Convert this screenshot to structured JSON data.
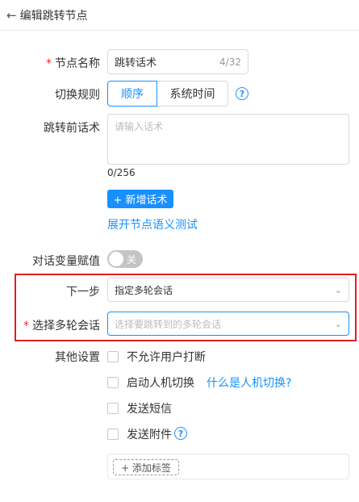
{
  "header": {
    "back_icon": "←",
    "title": "编辑跳转节点"
  },
  "node_name": {
    "label": "节点名称",
    "required_mark": "*",
    "value": "跳转话术",
    "count": "4/32"
  },
  "switch_rule": {
    "label": "切换规则",
    "options": [
      "顺序",
      "系统时间"
    ],
    "selected": "顺序",
    "help_icon": "?"
  },
  "pre_jump": {
    "label": "跳转前话术",
    "placeholder": "请输入话术",
    "count": "0/256",
    "add_button": "+ 新增话术",
    "expand_link": "展开节点语义测试"
  },
  "var_assign": {
    "label": "对话变量赋值",
    "toggle_text": "关"
  },
  "next_step": {
    "label": "下一步",
    "value": "指定多轮会话",
    "chevron": "⌄"
  },
  "multi_session": {
    "label": "选择多轮会话",
    "required_mark": "*",
    "placeholder": "选择要跳转到的多轮会话",
    "chevron": "⌄"
  },
  "other": {
    "label": "其他设置",
    "options": [
      "不允许用户打断",
      "启动人机切换",
      "发送短信",
      "发送附件"
    ],
    "handoff_link": "什么是人机切换?",
    "attach_help_icon": "?",
    "add_tag": "+ 添加标签"
  },
  "accent_color": "#1890ff",
  "highlight_color": "#e02020"
}
